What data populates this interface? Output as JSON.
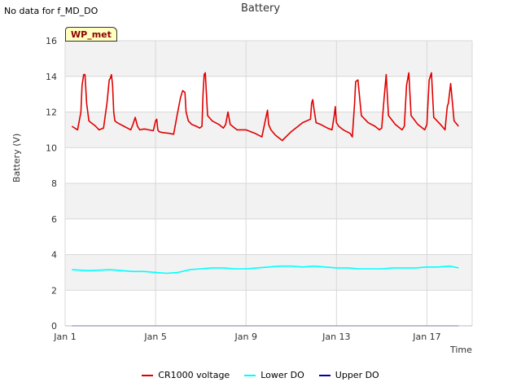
{
  "header": {
    "no_data_note": "No data for f_MD_DO",
    "site_badge": "WP_met"
  },
  "colors": {
    "cr1000": "#e00000",
    "lower_do": "#00ffff",
    "upper_do": "#0000aa",
    "band": "#f2f2f2",
    "grid": "#d8d8d8"
  },
  "chart_data": {
    "type": "line",
    "title": "Battery",
    "xlabel": "Time",
    "ylabel": "Battery (V)",
    "xlim": [
      "Jan 1",
      "Jan 19"
    ],
    "ylim": [
      0,
      16
    ],
    "xticks": [
      {
        "day": 1,
        "label": "Jan 1"
      },
      {
        "day": 5,
        "label": "Jan 5"
      },
      {
        "day": 9,
        "label": "Jan 9"
      },
      {
        "day": 13,
        "label": "Jan 13"
      },
      {
        "day": 17,
        "label": "Jan 17"
      }
    ],
    "yticks": [
      0,
      2,
      4,
      6,
      8,
      10,
      12,
      14,
      16
    ],
    "grid": true,
    "legend_position": "bottom",
    "series": [
      {
        "name": "CR1000 voltage",
        "color": "#e00000",
        "x": [
          1.3,
          1.55,
          1.7,
          1.75,
          1.82,
          1.88,
          1.95,
          2.05,
          2.15,
          2.25,
          2.35,
          2.5,
          2.7,
          2.85,
          2.95,
          3.0,
          3.05,
          3.1,
          3.15,
          3.2,
          3.3,
          3.45,
          3.6,
          3.75,
          3.9,
          4.0,
          4.1,
          4.2,
          4.3,
          4.5,
          4.7,
          4.9,
          5.0,
          5.05,
          5.1,
          5.15,
          5.3,
          5.6,
          5.8,
          5.95,
          6.1,
          6.2,
          6.3,
          6.35,
          6.45,
          6.6,
          6.8,
          6.95,
          7.05,
          7.1,
          7.15,
          7.2,
          7.3,
          7.5,
          7.8,
          8.0,
          8.1,
          8.2,
          8.3,
          8.6,
          9.0,
          9.4,
          9.7,
          9.85,
          9.95,
          10.0,
          10.1,
          10.3,
          10.6,
          11.0,
          11.5,
          11.85,
          11.9,
          11.95,
          12.0,
          12.1,
          12.3,
          12.6,
          12.8,
          12.9,
          12.95,
          13.0,
          13.1,
          13.3,
          13.6,
          13.7,
          13.8,
          13.85,
          13.95,
          14.1,
          14.4,
          14.7,
          14.9,
          15.0,
          15.1,
          15.2,
          15.3,
          15.6,
          15.9,
          16.0,
          16.1,
          16.2,
          16.3,
          16.6,
          16.9,
          17.0,
          17.1,
          17.2,
          17.3,
          17.6,
          17.8,
          17.9,
          17.95,
          18.05,
          18.2,
          18.4
        ],
        "values": [
          11.2,
          11.0,
          12.0,
          13.5,
          14.1,
          14.1,
          12.5,
          11.5,
          11.4,
          11.3,
          11.2,
          11.0,
          11.1,
          12.5,
          13.8,
          13.9,
          14.1,
          13.5,
          12.0,
          11.5,
          11.4,
          11.3,
          11.2,
          11.1,
          11.0,
          11.3,
          11.7,
          11.2,
          11.0,
          11.05,
          11.0,
          10.95,
          11.5,
          11.6,
          11.0,
          10.9,
          10.85,
          10.8,
          10.75,
          11.8,
          12.8,
          13.2,
          13.1,
          12.0,
          11.5,
          11.3,
          11.2,
          11.1,
          11.2,
          13.0,
          14.1,
          14.2,
          11.8,
          11.5,
          11.3,
          11.1,
          11.3,
          12.0,
          11.3,
          11.0,
          11.0,
          10.8,
          10.6,
          11.5,
          12.1,
          11.3,
          11.0,
          10.7,
          10.4,
          10.9,
          11.4,
          11.6,
          12.5,
          12.7,
          12.2,
          11.4,
          11.3,
          11.1,
          11.0,
          11.8,
          12.3,
          11.4,
          11.2,
          11.0,
          10.8,
          10.6,
          12.5,
          13.7,
          13.8,
          11.8,
          11.4,
          11.2,
          11.0,
          11.1,
          12.7,
          14.1,
          11.8,
          11.3,
          11.0,
          11.2,
          13.5,
          14.2,
          11.8,
          11.3,
          11.0,
          11.3,
          13.8,
          14.2,
          11.7,
          11.3,
          11.0,
          12.3,
          12.5,
          13.6,
          11.5,
          11.2
        ],
        "approximate": true
      },
      {
        "name": "Lower DO",
        "color": "#00ffff",
        "x": [
          1.3,
          2.0,
          3.0,
          3.5,
          4.0,
          4.5,
          5.0,
          5.5,
          6.0,
          6.5,
          7.0,
          7.5,
          8.0,
          8.5,
          9.0,
          9.5,
          10.0,
          10.5,
          11.0,
          11.5,
          12.0,
          12.5,
          13.0,
          13.5,
          14.0,
          14.5,
          15.0,
          15.5,
          16.0,
          16.5,
          17.0,
          17.5,
          18.0,
          18.4
        ],
        "values": [
          3.15,
          3.1,
          3.15,
          3.1,
          3.05,
          3.05,
          3.0,
          2.95,
          3.0,
          3.15,
          3.2,
          3.25,
          3.25,
          3.2,
          3.2,
          3.25,
          3.3,
          3.35,
          3.35,
          3.3,
          3.35,
          3.3,
          3.25,
          3.25,
          3.2,
          3.2,
          3.2,
          3.25,
          3.25,
          3.25,
          3.3,
          3.3,
          3.35,
          3.25
        ]
      },
      {
        "name": "Upper DO",
        "color": "#0000aa",
        "x": [
          1.3,
          18.4
        ],
        "values": [
          0.0,
          0.0
        ]
      }
    ]
  }
}
